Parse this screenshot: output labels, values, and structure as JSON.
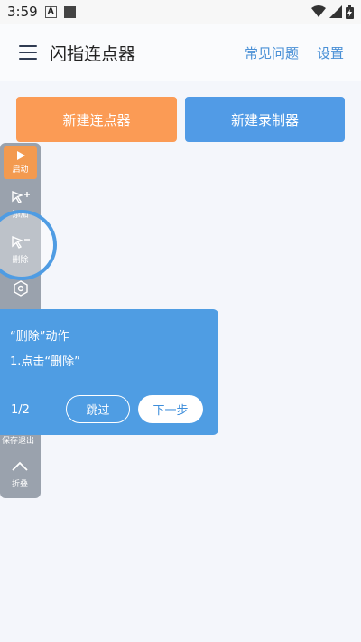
{
  "status": {
    "time": "3:59",
    "notif_letter": "A"
  },
  "header": {
    "title": "闪指连点器",
    "faq": "常见问题",
    "settings": "设置"
  },
  "main": {
    "new_clicker": "新建连点器",
    "new_recorder": "新建录制器"
  },
  "toolbar": {
    "start": "启动",
    "add": "添加",
    "delete": "删除",
    "save_exit": "保存退出",
    "fold": "折叠"
  },
  "guide": {
    "title": "“删除”动作",
    "step": "1.点击“删除”",
    "page": "1/2",
    "skip": "跳过",
    "next": "下一步"
  },
  "colors": {
    "accent_blue": "#4f9de3",
    "accent_orange": "#fb9b55",
    "toolbar_gray": "#9aa2ad"
  }
}
